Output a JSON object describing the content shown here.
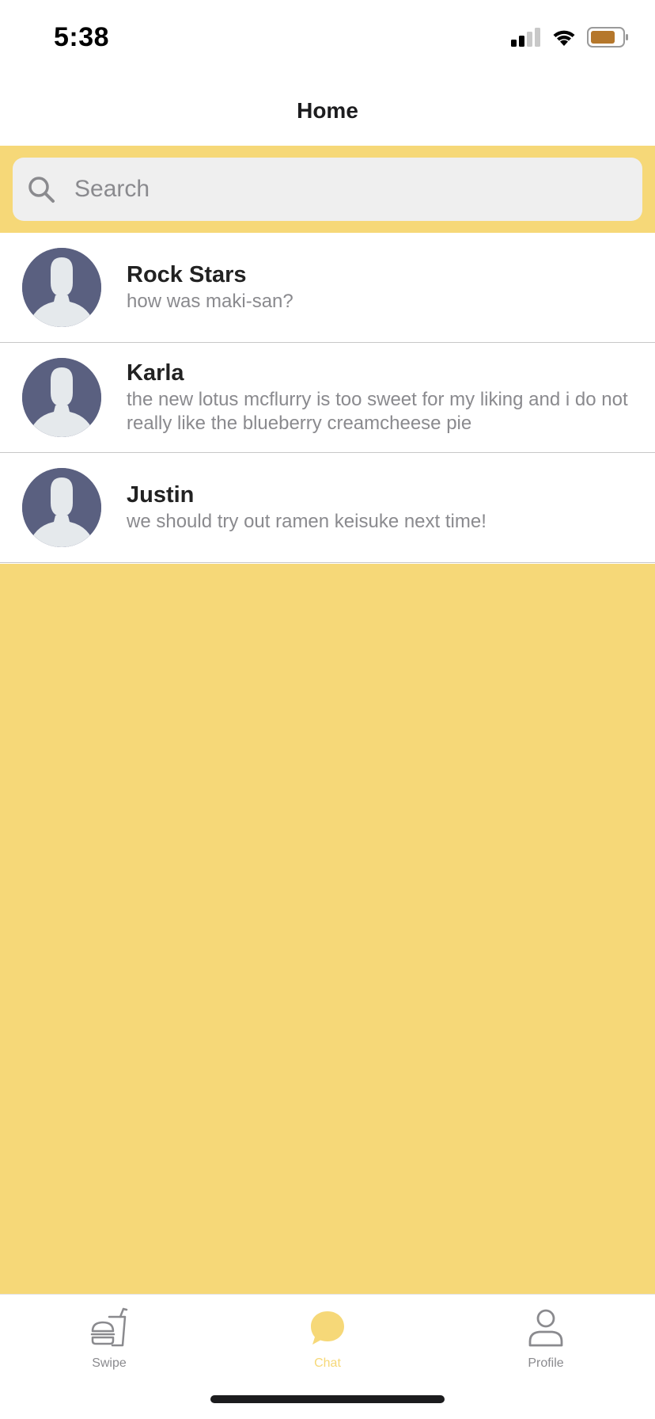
{
  "status_bar": {
    "time": "5:38"
  },
  "nav": {
    "title": "Home"
  },
  "search": {
    "placeholder": "Search",
    "value": ""
  },
  "chats": [
    {
      "name": "Rock Stars",
      "preview": "how was maki-san?"
    },
    {
      "name": "Karla",
      "preview": "the new lotus mcflurry is too sweet for my liking and i do not really like the blueberry creamcheese pie"
    },
    {
      "name": "Justin",
      "preview": "we should try out ramen keisuke next time!"
    }
  ],
  "tabs": [
    {
      "label": "Swipe",
      "icon": "burger-drink-icon",
      "active": false
    },
    {
      "label": "Chat",
      "icon": "chat-bubble-icon",
      "active": true
    },
    {
      "label": "Profile",
      "icon": "person-icon",
      "active": false
    }
  ],
  "colors": {
    "accent_yellow": "#f6d878",
    "active_tab": "#f6d878",
    "inactive_tab": "#8a8a8e",
    "avatar_bg": "#5a6080",
    "battery": "#b5772b"
  }
}
